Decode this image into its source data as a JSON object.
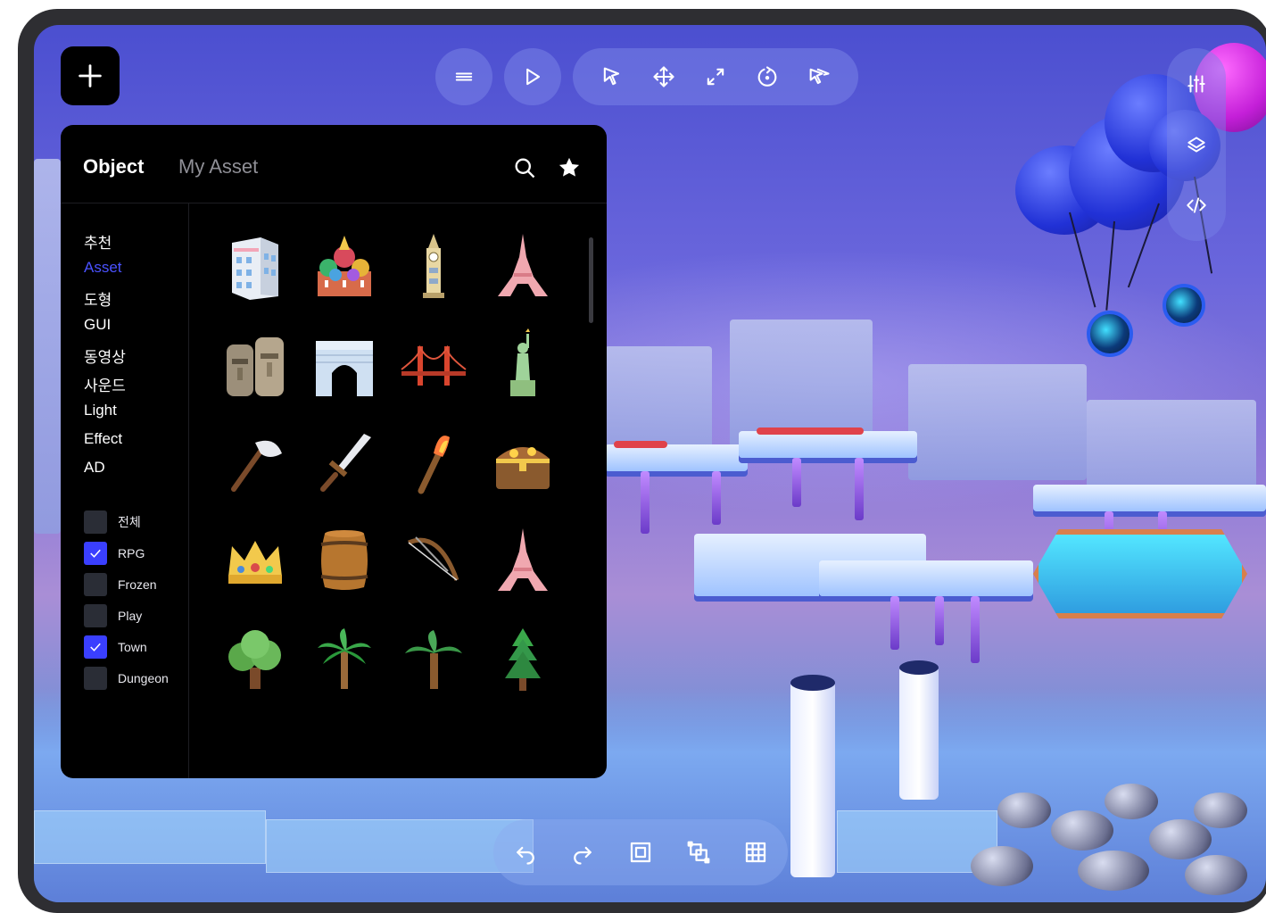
{
  "toolbar": {
    "add_icon": "plus-icon",
    "menu_icon": "hamburger-menu-icon",
    "play_icon": "play-icon",
    "tools": [
      "select-cursor-icon",
      "move-icon",
      "scale-icon",
      "rotate-icon",
      "multi-select-icon"
    ]
  },
  "right_rail": [
    "sliders-icon",
    "layers-icon",
    "code-icon"
  ],
  "bottom_bar": [
    "undo-icon",
    "redo-icon",
    "group-icon",
    "ungroup-icon",
    "grid-icon"
  ],
  "panel": {
    "tabs": {
      "active": "Object",
      "inactive": "My Asset"
    },
    "head_icons": [
      "search-icon",
      "star-icon"
    ],
    "categories": [
      "추천",
      "Asset",
      "도형",
      "GUI",
      "동영상",
      "사운드",
      "Light",
      "Effect",
      "AD"
    ],
    "active_category": "Asset",
    "filters": [
      {
        "label": "전체",
        "checked": false
      },
      {
        "label": "RPG",
        "checked": true
      },
      {
        "label": "Frozen",
        "checked": false
      },
      {
        "label": "Play",
        "checked": false
      },
      {
        "label": "Town",
        "checked": true
      },
      {
        "label": "Dungeon",
        "checked": false
      }
    ],
    "assets": [
      "building",
      "cathedral",
      "big-ben",
      "eiffel-tower",
      "moai-statues",
      "arc-de-triomphe",
      "golden-gate-bridge",
      "statue-of-liberty",
      "axe",
      "sword",
      "torch",
      "treasure-chest",
      "crown",
      "barrel",
      "bow",
      "eiffel-tower",
      "bushy-tree",
      "palm-tree",
      "palm-tree-2",
      "pine-tree"
    ]
  },
  "colors": {
    "accent": "#3a3fff",
    "active_category": "#4a52ff",
    "panel_bg": "#000000"
  }
}
